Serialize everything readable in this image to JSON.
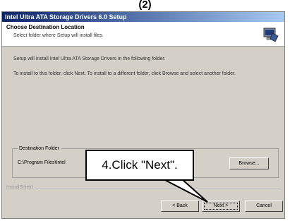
{
  "heading": "(2)",
  "window": {
    "title": "Intel Ultra ATA Storage Drivers 6.0 Setup",
    "header": {
      "title": "Choose Destination Location",
      "subtitle": "Select folder where Setup will install files."
    },
    "body": {
      "line1": "Setup will install Intel Ultra ATA Storage Drivers in the following folder.",
      "line2": "To install to this folder, click Next. To install to a different folder, click Browse and select another folder."
    },
    "destination": {
      "group_label": "Destination Folder",
      "path": "C:\\Program Files\\Intel"
    },
    "browse_label": "Browse...",
    "brand": "InstallShield",
    "buttons": {
      "back": "< Back",
      "next": "Next >",
      "cancel": "Cancel"
    }
  },
  "callout": {
    "text": "4.Click \"Next\"."
  },
  "colors": {
    "titlebar": "#0a246a",
    "dialog": "#d4d0c8"
  }
}
